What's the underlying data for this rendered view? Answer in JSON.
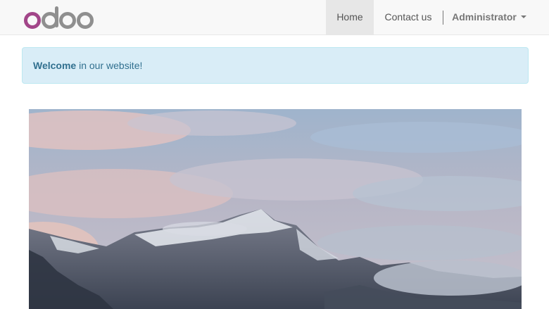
{
  "brand": {
    "name": "odoo",
    "colors": {
      "o_accent": "#a24689",
      "letters": "#8f8f8f"
    }
  },
  "nav": {
    "home_label": "Home",
    "contact_label": "Contact us",
    "user_label": "Administrator",
    "user_menu_icon": "caret-down-icon"
  },
  "alert": {
    "strong": "Welcome",
    "rest": " in our website!"
  },
  "hero": {
    "image": "snowy-mountain-landscape"
  },
  "colors": {
    "alert_bg": "#d9edf7",
    "alert_text": "#31708f",
    "navbar_bg": "#f8f8f8",
    "active_tab_bg": "#e7e7e7"
  }
}
